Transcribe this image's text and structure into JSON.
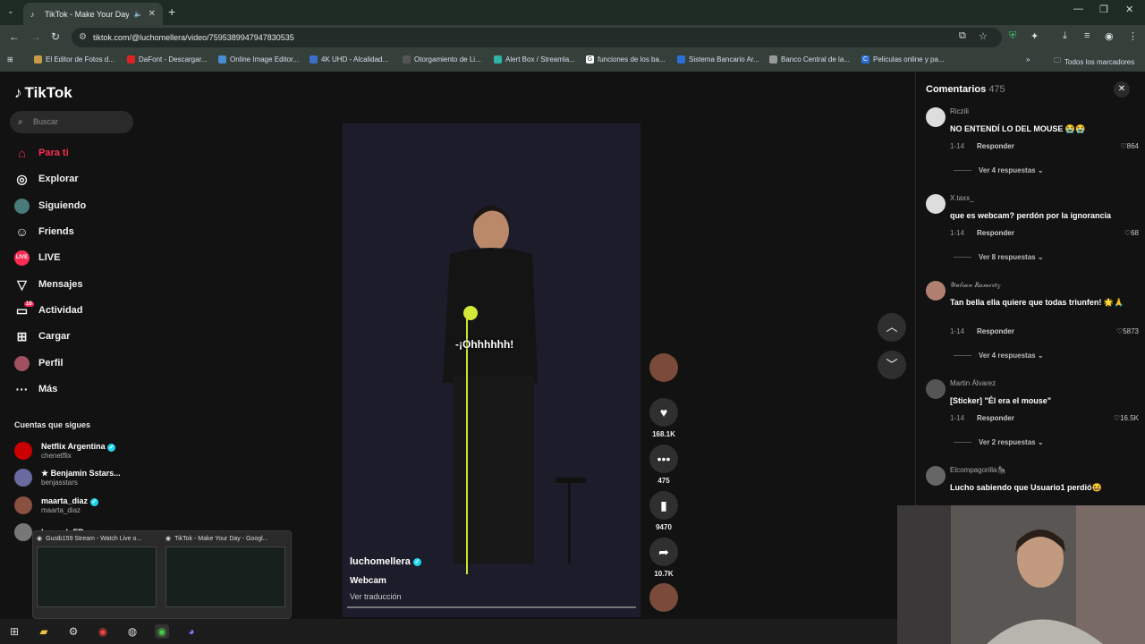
{
  "browser": {
    "tab_title": "TikTok - Make Your Day",
    "url": "tiktok.com/@luchomellera/video/7595389947947830535",
    "bookmarks": [
      "El Editor de Fotos d...",
      "DaFont - Descargar...",
      "Online Image Editor...",
      "4K UHD - Alcalidad...",
      "Otorgamiento de Li...",
      "Alert Box / Streamla...",
      "funciones de los ba...",
      "Sistema Bancario Ar...",
      "Banco Central de la...",
      "Peliculas online y pa..."
    ],
    "all_bookmarks": "Todos los marcadores"
  },
  "sidebar": {
    "logo": "TikTok",
    "search_placeholder": "Buscar",
    "nav": [
      {
        "label": "Para ti",
        "icon": "home-icon"
      },
      {
        "label": "Explorar",
        "icon": "compass-icon"
      },
      {
        "label": "Siguiendo",
        "icon": "following-icon"
      },
      {
        "label": "Friends",
        "icon": "friends-icon"
      },
      {
        "label": "LIVE",
        "icon": "live-icon"
      },
      {
        "label": "Mensajes",
        "icon": "inbox-icon"
      },
      {
        "label": "Actividad",
        "icon": "activity-icon"
      },
      {
        "label": "Cargar",
        "icon": "upload-icon"
      },
      {
        "label": "Perfil",
        "icon": "profile-icon"
      },
      {
        "label": "Más",
        "icon": "more-icon"
      }
    ],
    "activity_badge": "10",
    "following_title": "Cuentas que sigues",
    "accounts": [
      {
        "name": "Netflix Argentina",
        "handle": "chenetflix"
      },
      {
        "name": "★ Benjamin Sstars...",
        "handle": "benjasstars"
      },
      {
        "name": "maarta_diaz",
        "handle": "maarta_diaz"
      },
      {
        "name": "LucardoFR",
        "handle": ""
      }
    ]
  },
  "video": {
    "caption": "-¡Ohhhhhh!",
    "author": "luchomellera",
    "description": "Webcam",
    "translate": "Ver traducción"
  },
  "actions": {
    "likes": "168.1K",
    "comments": "475",
    "saves": "9470",
    "shares": "10.7K"
  },
  "comments_panel": {
    "title": "Comentarios",
    "count": "475",
    "reply_label": "Responder",
    "items": [
      {
        "user": "Riczili",
        "text": "NO ENTENDÍ LO DEL MOUSE 😭😭",
        "date": "1-14",
        "likes": "864",
        "more": "Ver 4 respuestas"
      },
      {
        "user": "X.taxx_",
        "text": "que es webcam? perdón por la ignorancia",
        "date": "1-14",
        "likes": "68",
        "more": "Ver 8 respuestas"
      },
      {
        "user": "𝒴𝓊𝓁𝒾𝒶𝓃 𝑅𝒶𝓂𝒾𝓇𝑒𝓏",
        "text": "Tan bella ella quiere que todas triunfen! 🌟🙏",
        "date": "1-14",
        "likes": "5873",
        "more": "Ver 4 respuestas"
      },
      {
        "user": "Martin Álvarez",
        "text": "[Sticker] \"Él era el mouse\"",
        "date": "1-14",
        "likes": "16.5K",
        "more": "Ver 2 respuestas"
      },
      {
        "user": "Elcompagorilla🦍",
        "text": "Lucho sabiendo que Usuario1 perdió😆",
        "date": "",
        "likes": "",
        "more": ""
      }
    ]
  },
  "taskbar_preview": {
    "items": [
      "Gustb159 Stream - Watch Live o...",
      "TikTok - Make Your Day - Googl..."
    ]
  },
  "colors": {
    "accent": "#fe2c55",
    "verified": "#20d5ec"
  }
}
